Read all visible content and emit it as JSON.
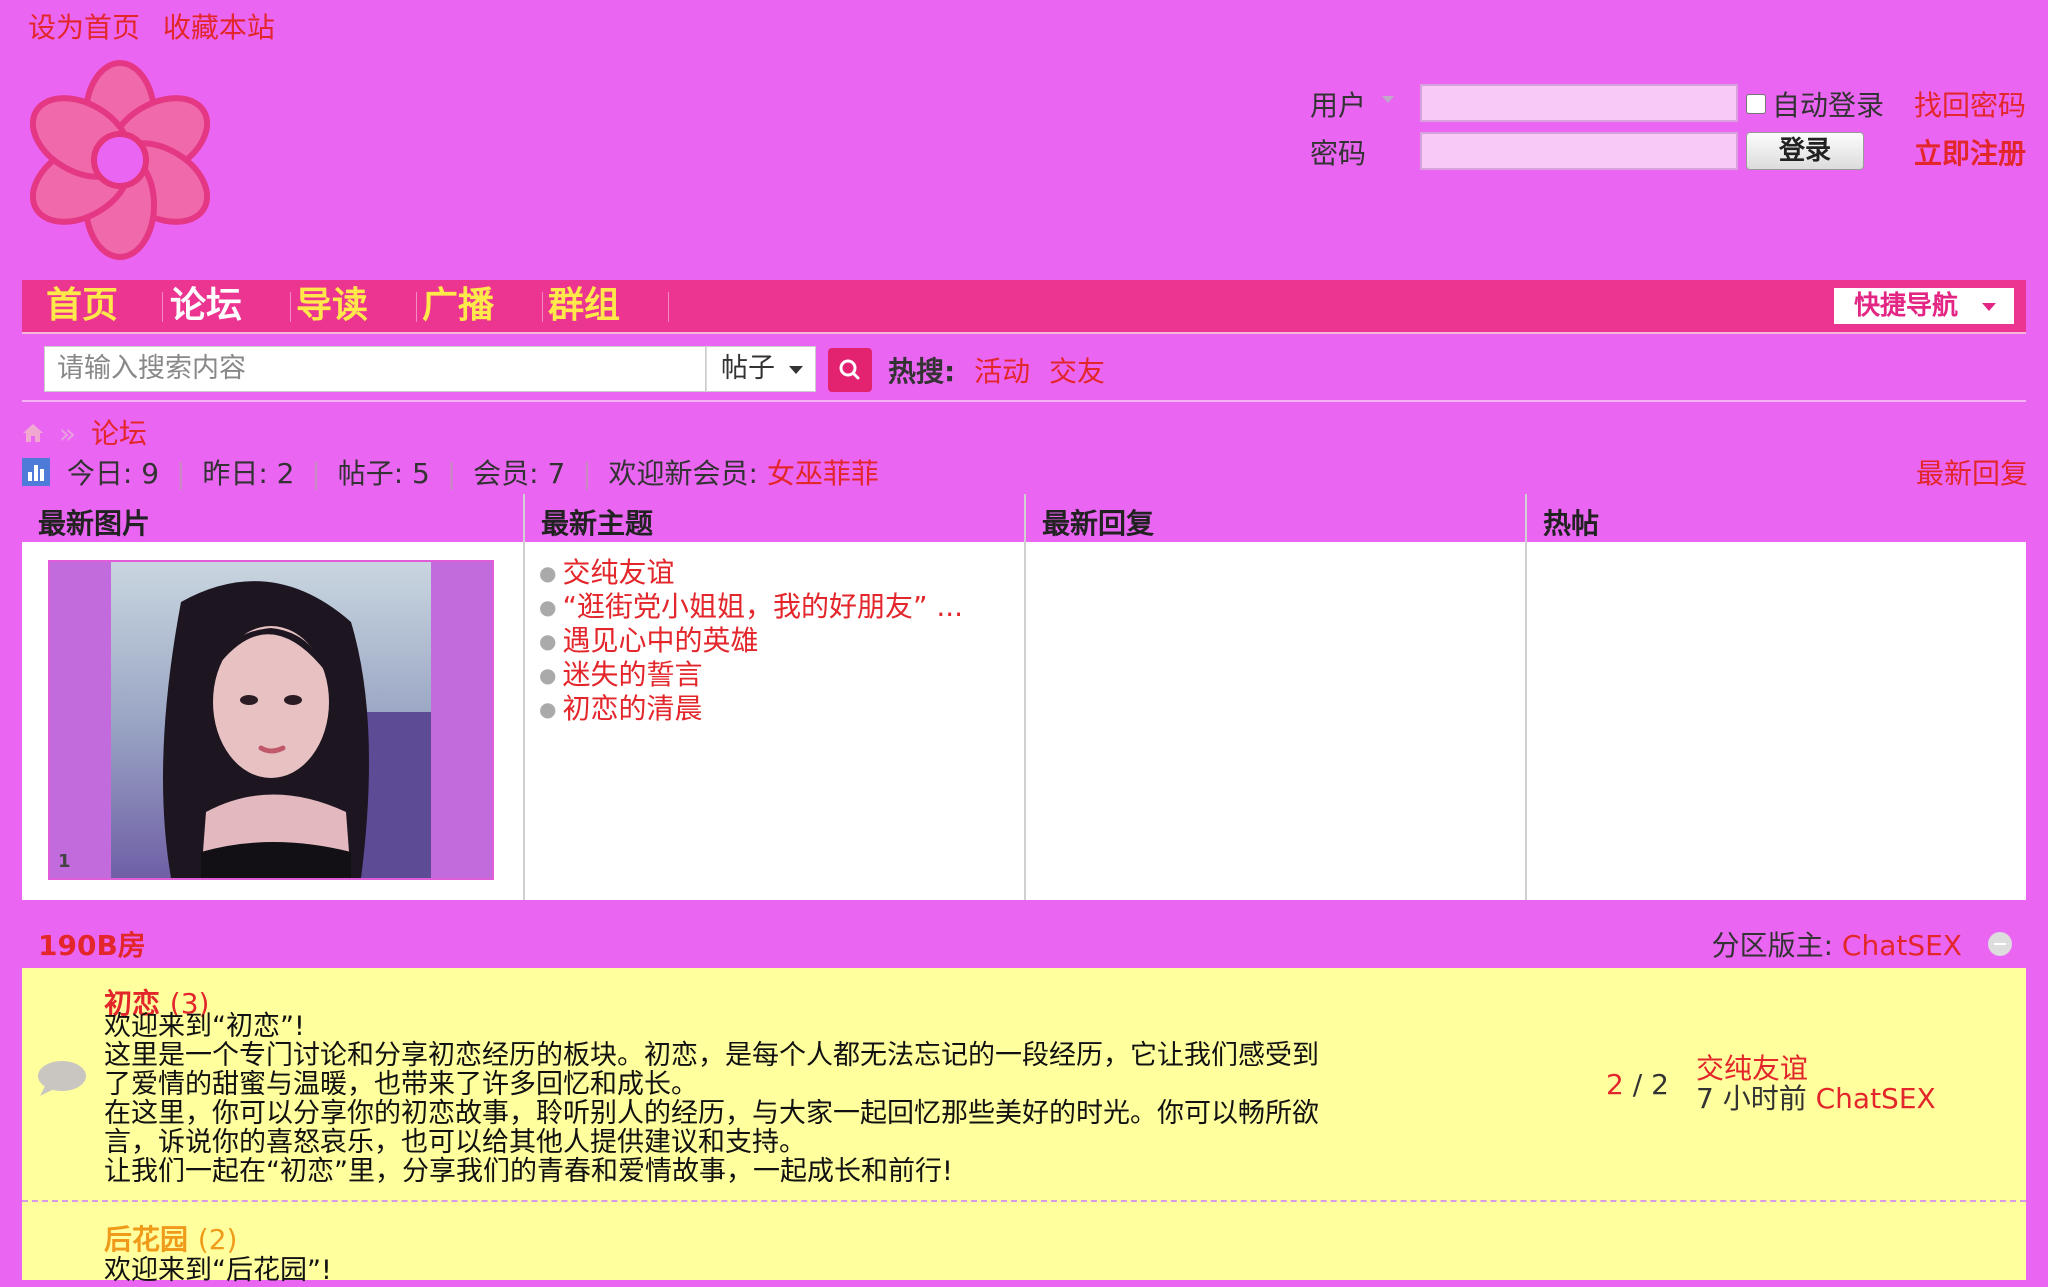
{
  "top_links": {
    "set_home": "设为首页",
    "bookmark": "收藏本站"
  },
  "login": {
    "user_label": "用户",
    "pass_label": "密码",
    "auto_login": "自动登录",
    "forgot": "找回密码",
    "login_btn": "登录",
    "register": "立即注册"
  },
  "nav": {
    "items": [
      "首页",
      "论坛",
      "导读",
      "广播",
      "群组"
    ],
    "active_index": 1,
    "quick": "快捷导航"
  },
  "search": {
    "placeholder": "请输入搜索内容",
    "type": "帖子",
    "hot_label": "热搜:",
    "hot_items": [
      "活动",
      "交友"
    ]
  },
  "breadcrumb": {
    "current": "论坛"
  },
  "stats": {
    "today": "今日: 9",
    "yesterday": "昨日: 2",
    "posts": "帖子: 5",
    "members": "会员: 7",
    "welcome": "欢迎新会员:",
    "new_member": "女巫菲菲",
    "latest_reply_link": "最新回复"
  },
  "grid": {
    "headers": [
      "最新图片",
      "最新主题",
      "最新回复",
      "热帖"
    ],
    "photo_index": "1",
    "threads": [
      "交纯友谊",
      "“逛街党小姐姐，我的好朋友” ...",
      "遇见心中的英雄",
      "迷失的誓言",
      "初恋的清晨"
    ]
  },
  "section": {
    "name": "190B房",
    "moderator_label": "分区版主:",
    "moderator": "ChatSEX"
  },
  "forums": [
    {
      "name": "初恋",
      "count": "(3)",
      "desc": [
        "欢迎来到“初恋”!",
        "这里是一个专门讨论和分享初恋经历的板块。初恋，是每个人都无法忘记的一段经历，它让我们感受到",
        "了爱情的甜蜜与温暖，也带来了许多回忆和成长。",
        "在这里，你可以分享你的初恋故事，聆听别人的经历，与大家一起回忆那些美好的时光。你可以畅所欲",
        "言，诉说你的喜怒哀乐，也可以给其他人提供建议和支持。",
        "让我们一起在“初恋”里，分享我们的青春和爱情故事，一起成长和前行!"
      ],
      "threads": "2",
      "posts": "/ 2",
      "last_title": "交纯友谊",
      "last_time": "7 小时前",
      "last_by": "ChatSEX"
    },
    {
      "name": "后花园",
      "count": "(2)",
      "desc_first": "欢迎来到“后花园”!"
    }
  ]
}
